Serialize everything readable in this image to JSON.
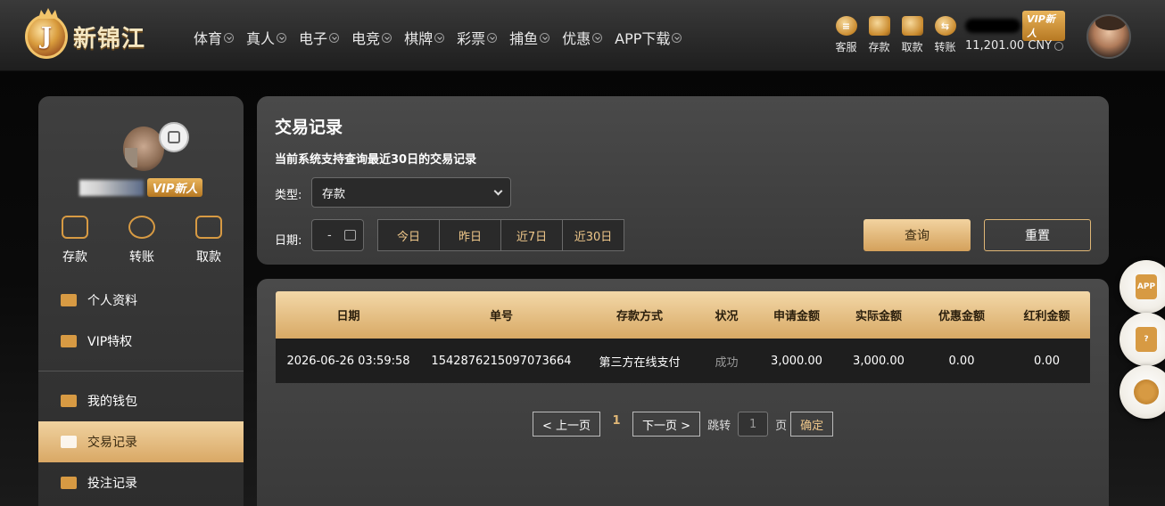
{
  "header": {
    "logo_letter": "J",
    "logo_text": "新锦江",
    "nav": [
      "体育",
      "真人",
      "电子",
      "电竞",
      "棋牌",
      "彩票",
      "捕鱼",
      "优惠",
      "APP下载"
    ],
    "tools": [
      {
        "label": "客服",
        "icon": "chat-icon"
      },
      {
        "label": "存款",
        "icon": "wallet-icon"
      },
      {
        "label": "取款",
        "icon": "withdraw-icon"
      },
      {
        "label": "转账",
        "icon": "transfer-icon"
      }
    ],
    "vip_label": "VIP新人",
    "balance": "11,201.00 CNY"
  },
  "sidebar": {
    "vip_label": "VIP新人",
    "quick": [
      {
        "label": "存款",
        "icon": "wallet-icon"
      },
      {
        "label": "转账",
        "icon": "transfer-icon"
      },
      {
        "label": "取款",
        "icon": "card-icon"
      }
    ],
    "menu": [
      {
        "label": "个人资料",
        "icon": "profile-card-icon"
      },
      {
        "label": "VIP特权",
        "icon": "vip-card-icon"
      },
      {
        "label": "我的钱包",
        "icon": "piggy-bank-icon"
      },
      {
        "label": "交易记录",
        "icon": "document-icon"
      },
      {
        "label": "投注记录",
        "icon": "clipboard-icon"
      }
    ]
  },
  "query": {
    "title": "交易记录",
    "subtitle": "当前系统支持查询最近30日的交易记录",
    "type_label": "类型:",
    "type_value": "存款",
    "date_label": "日期:",
    "date_value": "-",
    "quick_ranges": [
      "今日",
      "昨日",
      "近7日",
      "近30日"
    ],
    "query_button": "查询",
    "reset_button": "重置"
  },
  "results": {
    "columns": [
      "日期",
      "单号",
      "存款方式",
      "状况",
      "申请金额",
      "实际金额",
      "优惠金额",
      "红利金额"
    ],
    "rows": [
      [
        "2026-06-26 03:59:58",
        "1542876215097073664",
        "第三方在线支付",
        "成功",
        "3,000.00",
        "3,000.00",
        "0.00",
        "0.00"
      ]
    ]
  },
  "pager": {
    "prev": "< 上一页",
    "current": "1",
    "next": "下一页 >",
    "jump_label": "跳转",
    "jump_value": "1",
    "page_unit": "页",
    "confirm": "确定"
  },
  "floating": [
    {
      "icon": "app-download-icon",
      "text": "APP"
    },
    {
      "icon": "help-icon",
      "text": "?"
    },
    {
      "icon": "headset-icon",
      "text": ""
    }
  ],
  "colors": {
    "accent_gold": "#d79a43",
    "gold_gradient_top": "#f2d3a0",
    "gold_gradient_bottom": "#d4a15b",
    "panel": "#444444",
    "highlight_text": "#f0c88a"
  }
}
